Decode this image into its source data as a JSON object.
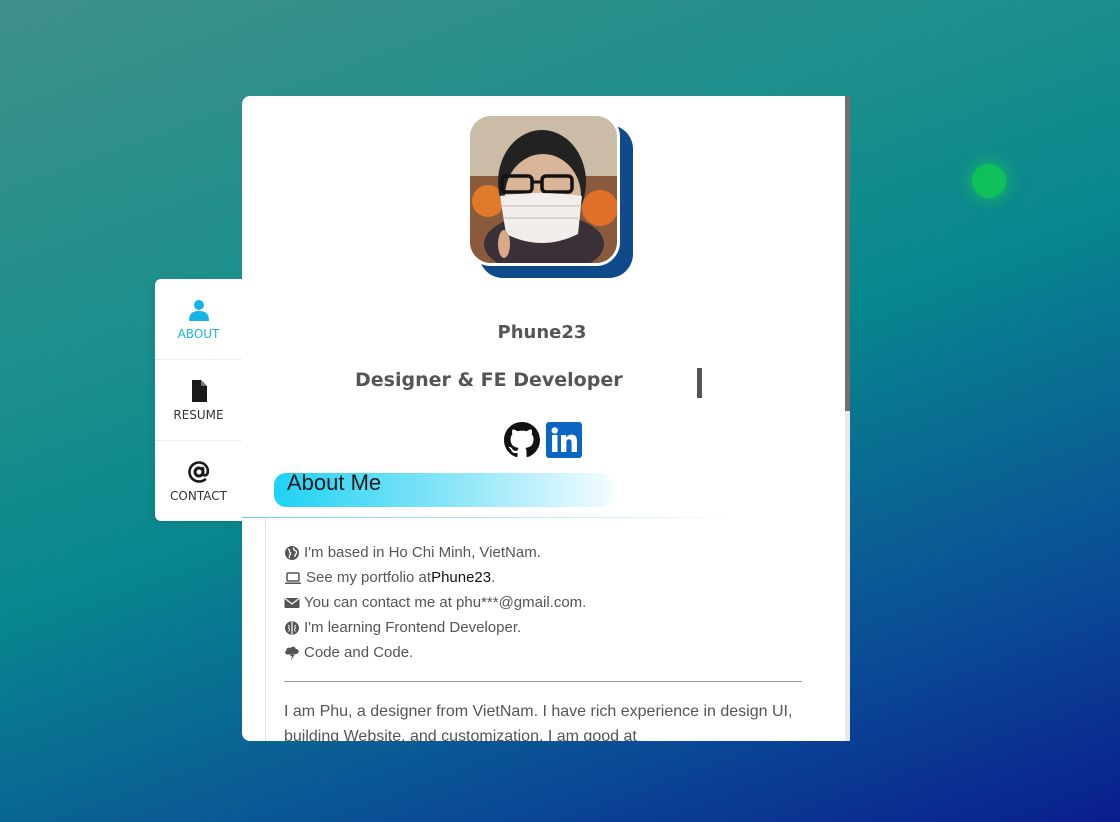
{
  "nav": {
    "items": [
      {
        "label": "ABOUT",
        "icon": "user-icon",
        "active": true
      },
      {
        "label": "RESUME",
        "icon": "file-icon",
        "active": false
      },
      {
        "label": "CONTACT",
        "icon": "at-icon",
        "active": false
      }
    ]
  },
  "profile": {
    "name": "Phune23",
    "role": "Designer & FE Developer",
    "avatar": "profile-photo"
  },
  "social": [
    {
      "icon": "github-icon"
    },
    {
      "icon": "linkedin-icon"
    }
  ],
  "about": {
    "title": "About Me",
    "facts": [
      {
        "icon": "globe-icon",
        "text": "I'm based in Ho Chi Minh, VietNam."
      },
      {
        "icon": "laptop-icon",
        "prefix": "See my portfolio at ",
        "link": "Phune23",
        "suffix": "."
      },
      {
        "icon": "envelope-icon",
        "text": "You can contact me at phu***@gmail.com."
      },
      {
        "icon": "brain-icon",
        "text": "I'm learning Frontend Developer."
      },
      {
        "icon": "lightning-cloud-icon",
        "text": "Code and Code."
      }
    ],
    "bio": "I am Phu, a designer from VietNam. I have rich experience in design UI, building Website, and customization. I am good at"
  },
  "colors": {
    "accent": "#17b3e6",
    "avatar_back": "#0f4a8a",
    "text": "#555555",
    "glow": "#0fbf5a"
  }
}
